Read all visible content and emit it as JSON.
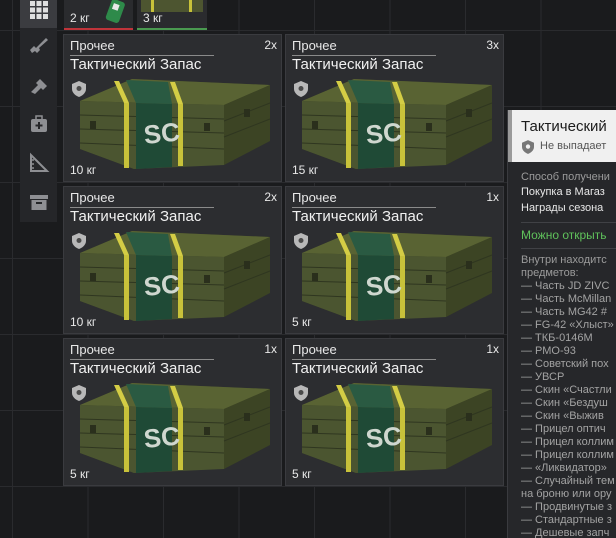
{
  "top_tiles": [
    {
      "weight": "2 кг",
      "accent": "#c0343a"
    },
    {
      "weight": "3 кг",
      "accent": "#4a9a50"
    }
  ],
  "sidebar": [
    {
      "icon": "grid-icon"
    },
    {
      "icon": "rifle-icon"
    },
    {
      "icon": "pistol-icon"
    },
    {
      "icon": "medkit-icon"
    },
    {
      "icon": "ruler-icon"
    },
    {
      "icon": "archive-icon"
    }
  ],
  "items": [
    {
      "category": "Прочее",
      "name": "Тактический Запас",
      "count": "2x",
      "weight": "10 кг"
    },
    {
      "category": "Прочее",
      "name": "Тактический Запас",
      "count": "3x",
      "weight": "15 кг"
    },
    {
      "category": "Прочее",
      "name": "Тактический Запас",
      "count": "2x",
      "weight": "10 кг"
    },
    {
      "category": "Прочее",
      "name": "Тактический Запас",
      "count": "1x",
      "weight": "5 кг"
    },
    {
      "category": "Прочее",
      "name": "Тактический Запас",
      "count": "1x",
      "weight": "5 кг"
    },
    {
      "category": "Прочее",
      "name": "Тактический Запас",
      "count": "1x",
      "weight": "5 кг"
    }
  ],
  "tooltip": {
    "title": "Тактический",
    "subtitle": "Не выпадает",
    "obtain_label": "Способ получени",
    "obtain_1": "Покупка в Магаз",
    "obtain_2": "Награды сезона",
    "openable": "Можно открыть",
    "contents_1": "Внутри находитс",
    "contents_2": "предметов:",
    "contents": [
      "— Часть JD ZIVC",
      "— Часть McMillan",
      "— Часть MG42 #",
      "— FG-42 «Хлыст»",
      "— ТКБ-0146М",
      "— РМО-93",
      "— Советский пох",
      "— УВСР",
      "— Скин «Счастли",
      "— Скин «Бездуш",
      "— Скин «Выжив",
      "— Прицел оптич",
      "— Прицел коллим",
      "— Прицел коллим",
      "— «Ликвидатор»",
      "— Случайный тем",
      "на броню или ору",
      "— Продвинутые з",
      "— Стандартные з",
      "— Дешевые запч"
    ]
  },
  "colors": {
    "background": "#1a1b1d",
    "card": "#2c2d30",
    "openable_green": "#5fc15b",
    "crate_olive": "#4f5a32",
    "crate_stripe": "#c8c23a",
    "crate_band": "#1f4a36"
  }
}
